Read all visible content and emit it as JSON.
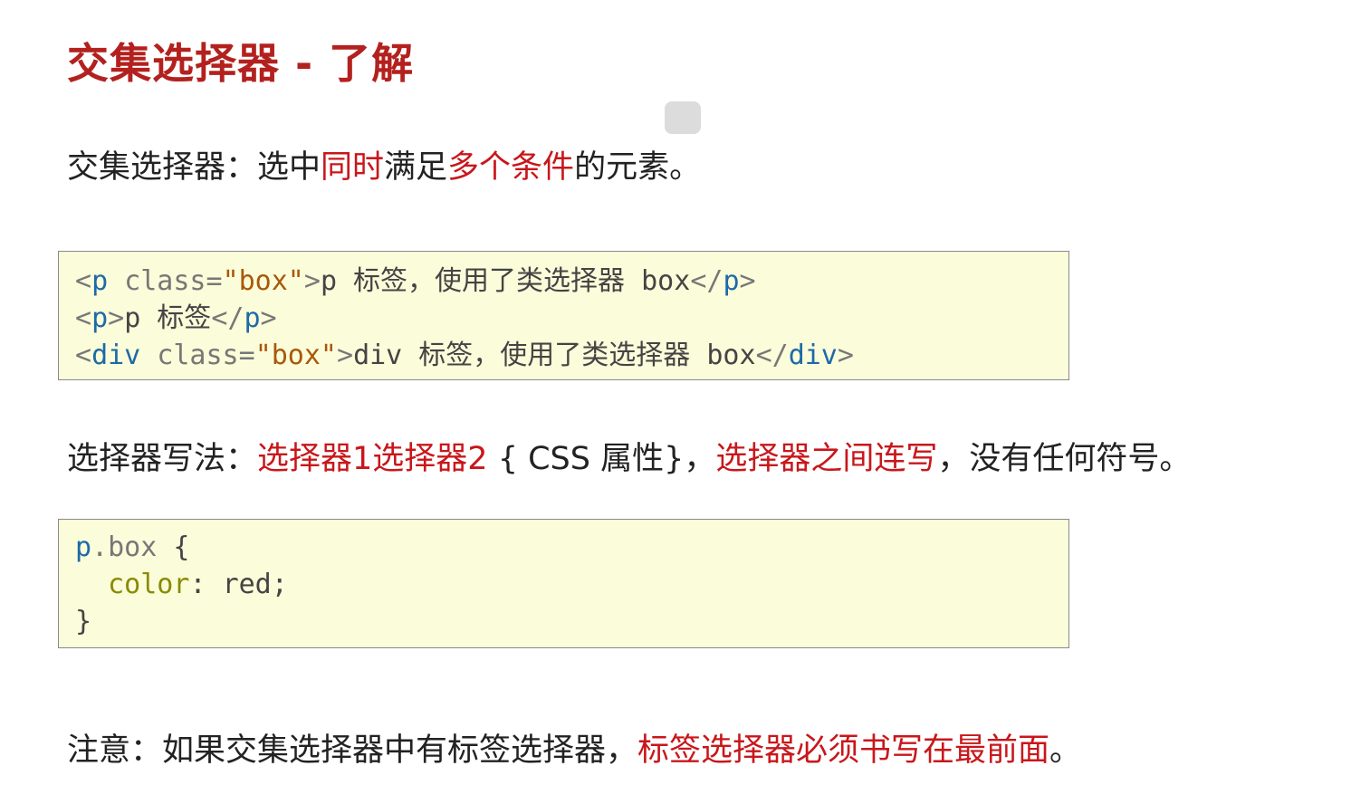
{
  "title": "交集选择器 - 了解",
  "definition": {
    "prefix": "交集选择器：选中",
    "hl1": "同时",
    "mid": "满足",
    "hl2": "多个条件",
    "suffix": "的元素。"
  },
  "code_html": [
    {
      "open_tag": "p",
      "attr": "class",
      "value": "\"box\"",
      "text": "p 标签，使用了类选择器 box",
      "close_tag": "p"
    },
    {
      "open_tag": "p",
      "attr": "",
      "value": "",
      "text": "p 标签",
      "close_tag": "p"
    },
    {
      "open_tag": "div",
      "attr": "class",
      "value": "\"box\"",
      "text": "div 标签，使用了类选择器 box",
      "close_tag": "div"
    }
  ],
  "syntax": {
    "prefix": "选择器写法：",
    "hl1": "选择器1选择器2",
    "mid": " { CSS 属性}，",
    "hl2": "选择器之间连写",
    "suffix": "，没有任何符号。"
  },
  "code_css": {
    "selector_tag": "p",
    "selector_class": ".box",
    "open_brace": " {",
    "property": "color",
    "value": "red;",
    "close_brace": "}"
  },
  "note": {
    "prefix": "注意：如果交集选择器中有标签选择器，",
    "hl": "标签选择器必须书写在最前面",
    "suffix": "。"
  }
}
